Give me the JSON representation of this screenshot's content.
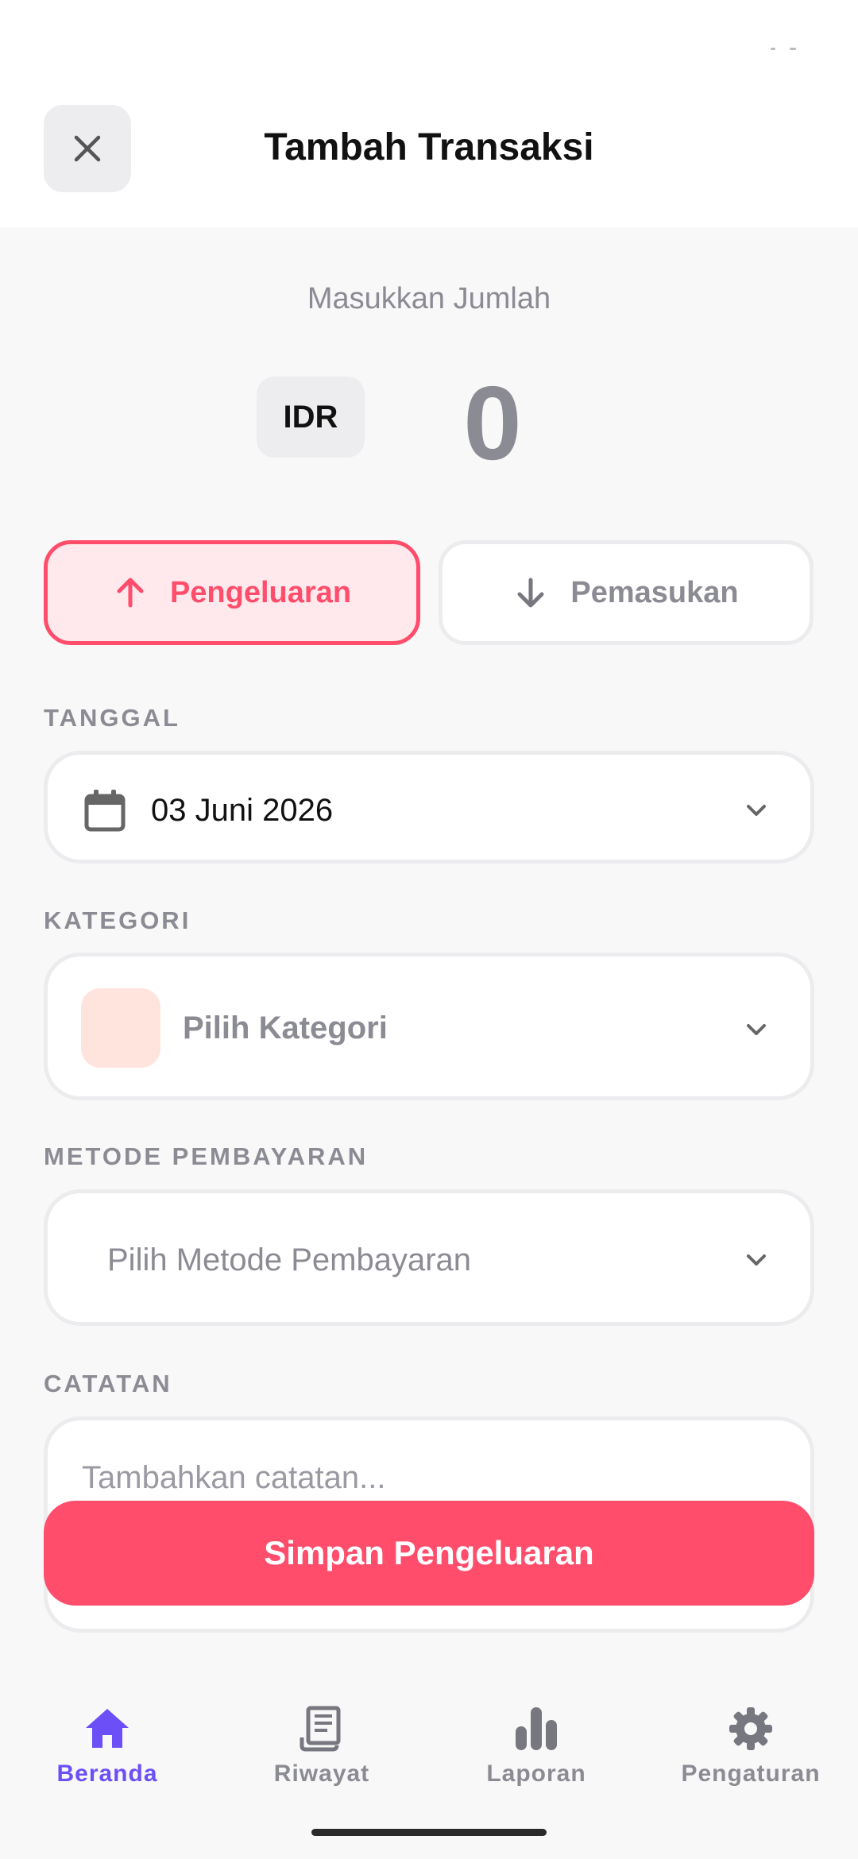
{
  "header": {
    "title": "Tambah Transaksi",
    "close_icon": "close-icon"
  },
  "amount": {
    "label": "Masukkan Jumlah",
    "currency": "IDR",
    "value": "0"
  },
  "type_toggle": {
    "expense_label": "Pengeluaran",
    "income_label": "Pemasukan",
    "selected": "Pengeluaran",
    "expense_color": "#ff4d6b"
  },
  "date": {
    "label": "TANGGAL",
    "value": "03 Juni 2026"
  },
  "category": {
    "label": "KATEGORI",
    "placeholder": "Pilih Kategori"
  },
  "payment": {
    "label": "METODE PEMBAYARAN",
    "placeholder": "Pilih Metode Pembayaran"
  },
  "note": {
    "label": "CATATAN",
    "placeholder": "Tambahkan catatan..."
  },
  "save_button": {
    "label": "Simpan Pengeluaran"
  },
  "bottom_nav": {
    "items": [
      {
        "label": "Beranda",
        "icon": "home-icon",
        "active": true
      },
      {
        "label": "Riwayat",
        "icon": "receipt-icon",
        "active": false
      },
      {
        "label": "Laporan",
        "icon": "bar-chart-icon",
        "active": false
      },
      {
        "label": "Pengaturan",
        "icon": "gear-icon",
        "active": false
      }
    ],
    "active_color": "#6c4ff7"
  }
}
